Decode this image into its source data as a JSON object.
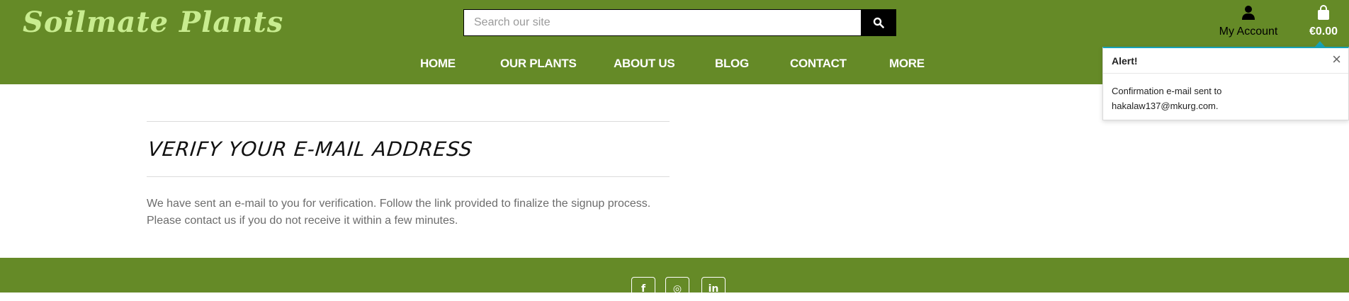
{
  "header": {
    "logo": "Soilmate Plants",
    "search": {
      "placeholder": "Search our site",
      "button_icon": "search-icon"
    },
    "account": {
      "label": "My Account",
      "icon": "user-icon"
    },
    "bag": {
      "label": "€0.00",
      "icon": "shopping-bag-icon"
    }
  },
  "nav": {
    "items": [
      {
        "label": "HOME"
      },
      {
        "label": "OUR PLANTS"
      },
      {
        "label": "ABOUT US"
      },
      {
        "label": "BLOG"
      },
      {
        "label": "CONTACT"
      },
      {
        "label": "MORE"
      }
    ]
  },
  "alert": {
    "title": "Alert!",
    "close": "×",
    "line1": "Confirmation e-mail sent to",
    "line2": "hakalaw137@mkurg.com.",
    "accent_color": "#17a2b8"
  },
  "main": {
    "title": "VERIFY YOUR E-MAIL ADDRESS",
    "line1": "We have sent an e-mail to you for verification. Follow the link provided to finalize the signup process.",
    "line2": "Please contact us if you do not receive it within a few minutes."
  },
  "footer": {
    "social": [
      {
        "glyph": "f",
        "icon": "facebook-icon"
      },
      {
        "glyph": "◎",
        "icon": "instagram-icon"
      },
      {
        "glyph": "in",
        "icon": "linkedin-icon"
      }
    ]
  },
  "colors": {
    "brand_green": "#658a27",
    "logo_green": "#c8ec8f"
  }
}
